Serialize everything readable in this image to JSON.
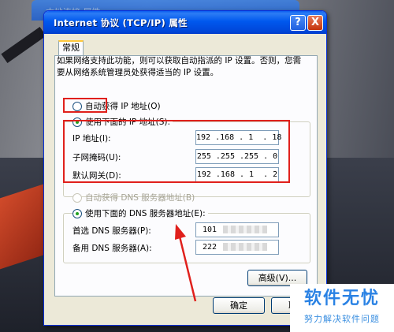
{
  "background_window": {
    "title": "本地连接 属性"
  },
  "dialog": {
    "title": "Internet 协议 (TCP/IP) 属性",
    "help_label": "?",
    "close_label": "X",
    "tab": "常规",
    "description": "如果网络支持此功能，则可以获取自动指派的 IP 设置。否则，您需要从网络系统管理员处获得适当的 IP 设置。",
    "auto_ip": "自动获得 IP 地址(O)",
    "manual_ip": "使用下面的 IP 地址(S):",
    "fields": [
      {
        "label": "IP 地址(I):",
        "value": "192 .168 . 1  . 18"
      },
      {
        "label": "子网掩码(U):",
        "value": "255 .255 .255 . 0"
      },
      {
        "label": "默认网关(D):",
        "value": "192 .168 . 1  . 2"
      }
    ],
    "auto_dns": "自动获得 DNS 服务器地址(B)",
    "manual_dns": "使用下面的 DNS 服务器地址(E):",
    "dns_fields": [
      {
        "label": "首选 DNS 服务器(P):",
        "value": "101"
      },
      {
        "label": "备用 DNS 服务器(A):",
        "value": "222"
      }
    ],
    "advanced_label": "高级(V)...",
    "ok_label": "确定",
    "cancel_label": "取消"
  },
  "watermark": {
    "main": "软件无忧",
    "sub": "努力解决软件问题"
  },
  "colors": {
    "highlight": "#e0201c",
    "titlebar": "#0054e3",
    "watermark": "#2a82e4"
  }
}
